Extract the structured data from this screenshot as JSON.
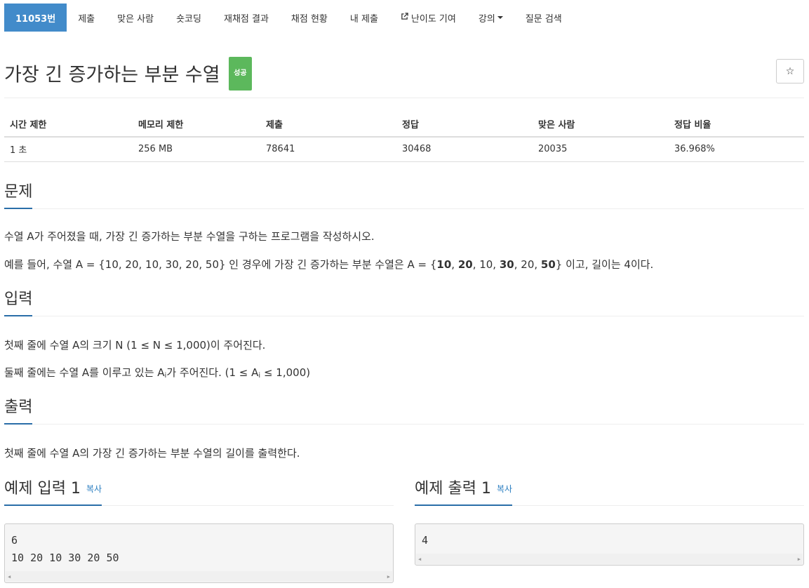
{
  "nav": {
    "problem_id": "11053번",
    "submit": "제출",
    "solved": "맞은 사람",
    "shortest": "숏코딩",
    "rejudge": "재채점 결과",
    "status": "채점 현황",
    "my_submit": "내 제출",
    "difficulty": "난이도 기여",
    "lecture": "강의",
    "qna": "질문 검색"
  },
  "problem": {
    "title": "가장 긴 증가하는 부분 수열",
    "status_badge": "성공",
    "star": "☆"
  },
  "info_table": {
    "headers": [
      "시간 제한",
      "메모리 제한",
      "제출",
      "정답",
      "맞은 사람",
      "정답 비율"
    ],
    "values": [
      "1 초",
      "256 MB",
      "78641",
      "30468",
      "20035",
      "36.968%"
    ]
  },
  "sections": {
    "problem_title": "문제",
    "problem_p1": "수열 A가 주어졌을 때, 가장 긴 증가하는 부분 수열을 구하는 프로그램을 작성하시오.",
    "problem_p2_a": "예를 들어, 수열 A = {10, 20, 10, 30, 20, 50} 인 경우에 가장 긴 증가하는 부분 수열은 A = {",
    "problem_p2_b1": "10",
    "problem_p2_s1": ", ",
    "problem_p2_b2": "20",
    "problem_p2_s2": ", 10, ",
    "problem_p2_b3": "30",
    "problem_p2_s3": ", 20, ",
    "problem_p2_b4": "50",
    "problem_p2_end": "} 이고, 길이는 4이다.",
    "input_title": "입력",
    "input_p1": "첫째 줄에 수열 A의 크기 N (1 ≤ N ≤ 1,000)이 주어진다.",
    "input_p2_a": "둘째 줄에는 수열 A를 이루고 있는 A",
    "input_p2_sub": "i",
    "input_p2_b": "가 주어진다. (1 ≤ A",
    "input_p2_sub2": "i",
    "input_p2_c": " ≤ 1,000)",
    "output_title": "출력",
    "output_p1": "첫째 줄에 수열 A의 가장 긴 증가하는 부분 수열의 길이를 출력한다."
  },
  "samples": {
    "copy_label": "복사",
    "input_title": "예제 입력 1",
    "input_lines": [
      "6",
      "10 20 10 30 20 50"
    ],
    "output_title": "예제 출력 1",
    "output_lines": [
      "4"
    ]
  },
  "colors": {
    "nav_active": "#428bca",
    "badge_success": "#5cb85c",
    "heading_underline": "#2a6ea8",
    "link": "#2a7ec1"
  }
}
